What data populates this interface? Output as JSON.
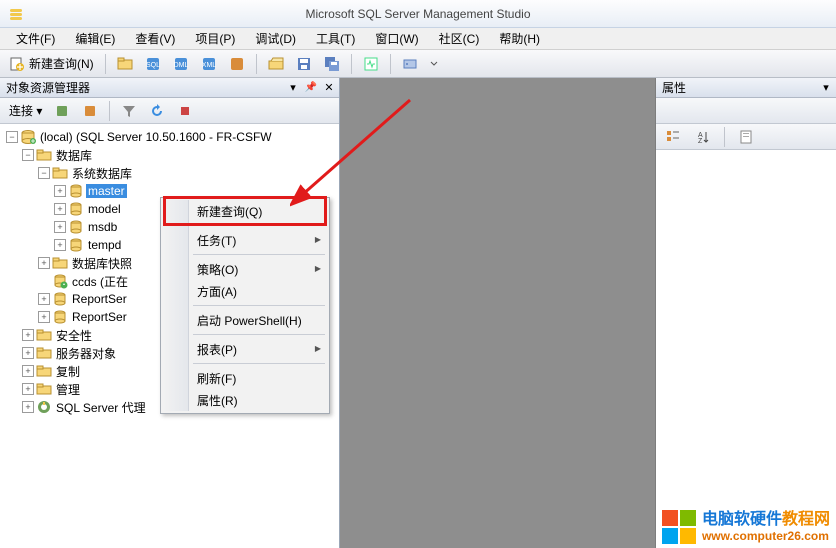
{
  "title": "Microsoft SQL Server Management Studio",
  "menu": [
    "文件(F)",
    "编辑(E)",
    "查看(V)",
    "项目(P)",
    "调试(D)",
    "工具(T)",
    "窗口(W)",
    "社区(C)",
    "帮助(H)"
  ],
  "toolbar": {
    "new_query": "新建查询(N)"
  },
  "left_panel": {
    "title": "对象资源管理器",
    "connect_label": "连接 ▾"
  },
  "tree": {
    "server": "(local) (SQL Server 10.50.1600 - FR-CSFW",
    "databases": "数据库",
    "sys_db": "系统数据库",
    "master": "master",
    "model": "model",
    "msdb": "msdb",
    "tempdb": "tempd",
    "snapshots": "数据库快照",
    "ccds": "ccds (正在",
    "reportserver1": "ReportSer",
    "reportserver2": "ReportSer",
    "security": "安全性",
    "server_objects": "服务器对象",
    "replication": "复制",
    "management": "管理",
    "sql_agent": "SQL Server 代理"
  },
  "context_menu": {
    "new_query": "新建查询(Q)",
    "tasks": "任务(T)",
    "policies": "策略(O)",
    "aspects": "方面(A)",
    "powershell": "启动 PowerShell(H)",
    "reports": "报表(P)",
    "refresh": "刷新(F)",
    "properties": "属性(R)"
  },
  "right_panel": {
    "title": "属性"
  },
  "watermark": {
    "logo_colors": [
      "#f25022",
      "#7fba00",
      "#00a4ef",
      "#ffb900"
    ],
    "text_cn_1": "电脑软硬件",
    "text_cn_2": "教程网",
    "url": "www.computer26.com"
  }
}
